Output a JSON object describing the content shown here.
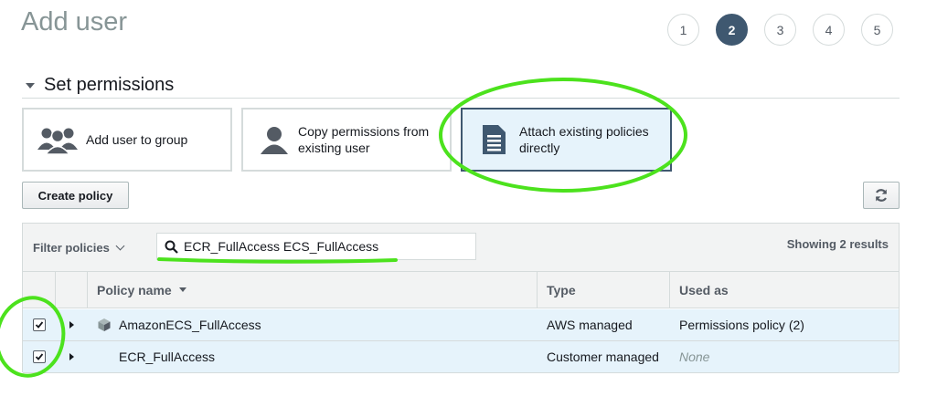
{
  "page": {
    "title": "Add user"
  },
  "wizard": {
    "steps": [
      "1",
      "2",
      "3",
      "4",
      "5"
    ],
    "active_step": "2"
  },
  "section": {
    "title": "Set permissions"
  },
  "permission_options": [
    {
      "label": "Add user to group",
      "icon": "users-icon"
    },
    {
      "label": "Copy permissions from existing user",
      "icon": "user-icon"
    },
    {
      "label": "Attach existing policies directly",
      "icon": "document-icon",
      "selected": true
    }
  ],
  "toolbar": {
    "create_policy_label": "Create policy",
    "refresh_icon": "refresh-icon"
  },
  "filter": {
    "label": "Filter policies",
    "search_value": "ECR_FullAccess ECS_FullAccess",
    "results_text": "Showing 2 results"
  },
  "table": {
    "columns": [
      "Policy name",
      "Type",
      "Used as"
    ],
    "rows": [
      {
        "checked": true,
        "name": "AmazonECS_FullAccess",
        "icon": "aws-managed-icon",
        "type": "AWS managed",
        "used_as": "Permissions policy (2)"
      },
      {
        "checked": true,
        "name": "ECR_FullAccess",
        "type": "Customer managed",
        "used_as": "None"
      }
    ]
  },
  "colors": {
    "accent": "#3f5870",
    "selected_bg": "#e6f3fb",
    "annotation": "#4ce21d",
    "border": "#d5dbdb"
  }
}
